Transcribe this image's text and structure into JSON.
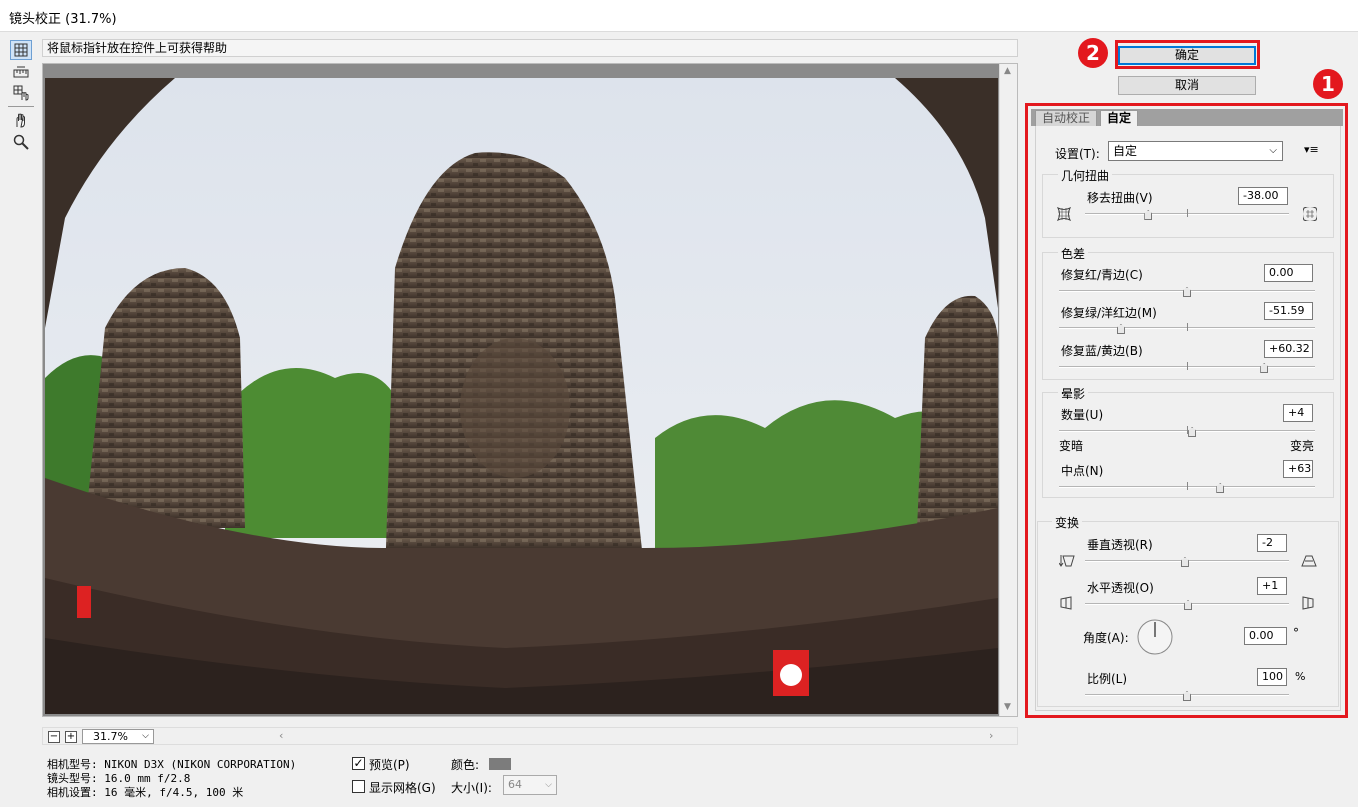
{
  "window": {
    "title": "镜头校正 (31.7%)"
  },
  "hint": "将鼠标指针放在控件上可获得帮助",
  "zoom": {
    "minus": "−",
    "plus": "+",
    "value": "31.7%"
  },
  "camera_info": [
    "相机型号: NIKON D3X (NIKON CORPORATION)",
    "镜头型号: 16.0 mm f/2.8",
    "相机设置: 16 毫米, f/4.5, 100 米"
  ],
  "options": {
    "preview_label": "预览(P)",
    "preview_checked": "✓",
    "grid_label": "显示网格(G)",
    "color_label": "颜色:",
    "size_label": "大小(I):",
    "size_value": "64"
  },
  "buttons": {
    "ok": "确定",
    "cancel": "取消"
  },
  "badges": {
    "one": "1",
    "two": "2"
  },
  "tabs": {
    "auto": "自动校正",
    "custom": "自定"
  },
  "settings": {
    "label": "设置(T):",
    "value": "自定"
  },
  "geometric": {
    "title": "几何扭曲",
    "remove_label": "移去扭曲(V)",
    "remove_value": "-38.00",
    "remove_level": -38
  },
  "chromatic": {
    "title": "色差",
    "red_label": "修复红/青边(C)",
    "red_value": "0.00",
    "red_level": 0,
    "green_label": "修复绿/洋红边(M)",
    "green_value": "-51.59",
    "green_level": -51.59,
    "blue_label": "修复蓝/黄边(B)",
    "blue_value": "+60.32",
    "blue_level": 60.32
  },
  "vignette": {
    "title": "晕影",
    "amount_label": "数量(U)",
    "amount_value": "+4",
    "amount_level": 4,
    "darken": "变暗",
    "lighten": "变亮",
    "midpoint_label": "中点(N)",
    "midpoint_value": "+63",
    "midpoint_level": 63
  },
  "transform": {
    "title": "变换",
    "vertical_label": "垂直透视(R)",
    "vertical_value": "-2",
    "vertical_level": -2,
    "horizontal_label": "水平透视(O)",
    "horizontal_value": "+1",
    "horizontal_level": 1,
    "angle_label": "角度(A):",
    "angle_value": "0.00",
    "angle_unit": "°",
    "scale_label": "比例(L)",
    "scale_value": "100",
    "scale_unit": "%",
    "scale_level": 0
  },
  "colors": {
    "accent_red": "#e3181e",
    "focus_blue": "#0078d7",
    "preview_gray": "#7c7c7c"
  }
}
